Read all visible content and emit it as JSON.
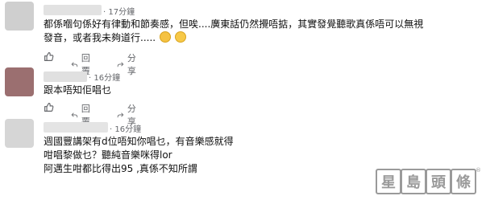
{
  "comments": [
    {
      "time": "17分鐘",
      "lines": [
        "都係嗰句係好有律動和節奏感，但唉....廣東話仍然攪唔掂，其實發覺聽歌真係唔可以無視",
        "發音，或者我未夠道行....."
      ],
      "emojis": [
        "face-with-tears-icon",
        "grinning-face-icon"
      ],
      "actions": {
        "reply": "回覆",
        "share": "分享"
      }
    },
    {
      "time": "16分鐘",
      "lines": [
        "跟本唔知佢唱乜"
      ],
      "actions": {
        "reply": "回覆",
        "share": "分享"
      }
    },
    {
      "time": "16分鐘",
      "lines": [
        "週國豐講架有d位唔知你唱乜，有音樂感就得",
        "咁唱黎做乜？聽純音樂咪得lor",
        "阿邁生咁都比得出95 ,真係不知所謂"
      ]
    }
  ],
  "separator": "·",
  "watermark": {
    "chars": [
      "星",
      "島",
      "頭",
      "條"
    ],
    "mark": "®"
  },
  "colors": {
    "secondary_text": "#65676b",
    "avatar_gray": "#cccccc",
    "avatar_brown": "#9b6f70",
    "avatar_light": "#d6d6d6",
    "watermark": "#9a9a9a"
  }
}
